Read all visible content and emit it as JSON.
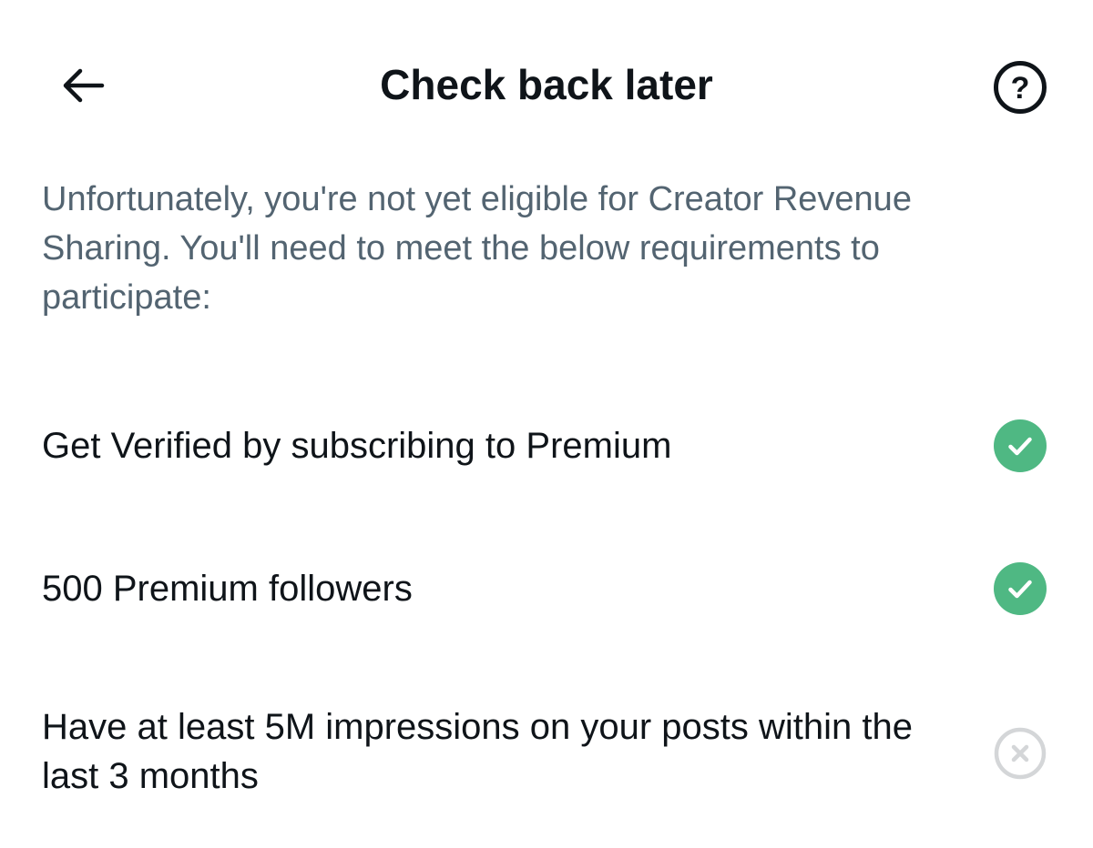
{
  "header": {
    "title": "Check back later",
    "back_icon": "arrow-left-icon",
    "help_icon": "question-circle-icon"
  },
  "intro": {
    "text": "Unfortunately, you're not yet eligible for Creator Revenue Sharing. You'll need to meet the below requirements to participate:"
  },
  "requirements": [
    {
      "label": "Get Verified by subscribing to Premium",
      "status": "met",
      "icon": "check-circle-icon"
    },
    {
      "label": "500 Premium followers",
      "status": "met",
      "icon": "check-circle-icon"
    },
    {
      "label": "Have at least 5M impressions on your posts within the last 3 months",
      "status": "not-met",
      "icon": "x-circle-icon"
    }
  ],
  "colors": {
    "met": "#4fb883",
    "not_met": "#d4d6d8",
    "text_primary": "#0f1419",
    "text_secondary": "#536471"
  }
}
